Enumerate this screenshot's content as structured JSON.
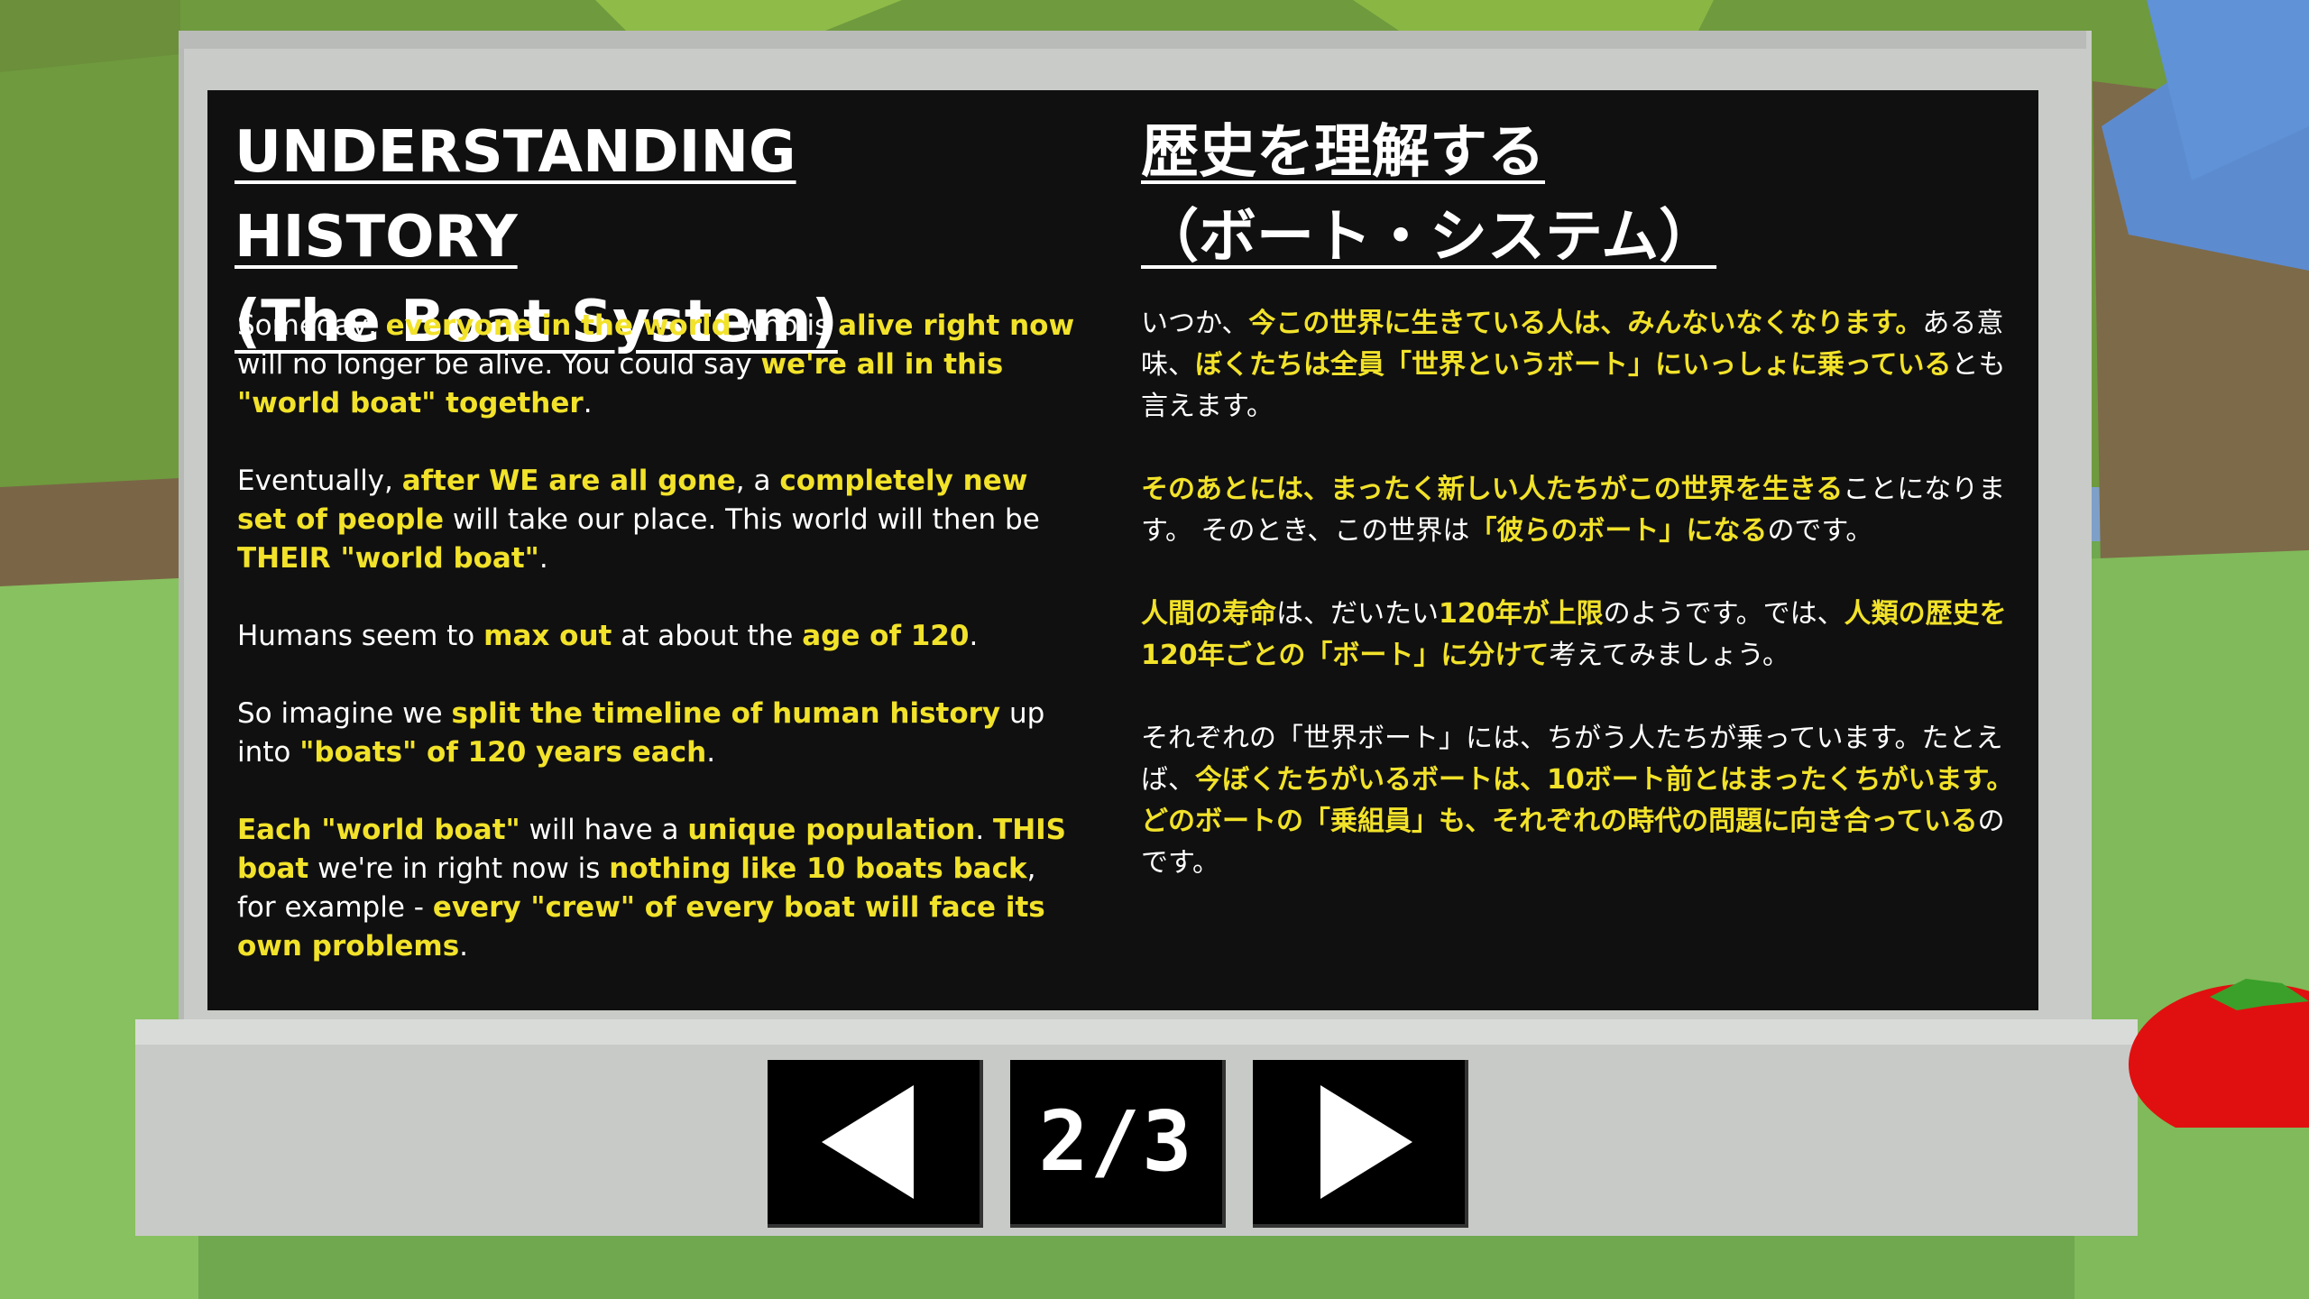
{
  "board": {
    "english": {
      "title_line1": "UNDERSTANDING HISTORY",
      "title_line2": "(The Boat System)",
      "paragraphs": [
        [
          {
            "t": "Someday, ",
            "h": false
          },
          {
            "t": "everyone in the world",
            "h": true
          },
          {
            "t": " who is ",
            "h": false
          },
          {
            "t": "alive right now",
            "h": true
          },
          {
            "t": " will no longer be alive. You could say ",
            "h": false
          },
          {
            "t": "we're all in this \"world boat\" together",
            "h": true
          },
          {
            "t": ".",
            "h": false
          }
        ],
        [
          {
            "t": "Eventually, ",
            "h": false
          },
          {
            "t": "after WE are all gone",
            "h": true
          },
          {
            "t": ", a ",
            "h": false
          },
          {
            "t": "completely new set of people",
            "h": true
          },
          {
            "t": " will take our place. This world will then be ",
            "h": false
          },
          {
            "t": "THEIR \"world boat\"",
            "h": true
          },
          {
            "t": ".",
            "h": false
          }
        ],
        [
          {
            "t": "Humans seem to ",
            "h": false
          },
          {
            "t": "max out",
            "h": true
          },
          {
            "t": " at about the ",
            "h": false
          },
          {
            "t": "age of 120",
            "h": true
          },
          {
            "t": ".",
            "h": false
          }
        ],
        [
          {
            "t": "So imagine we ",
            "h": false
          },
          {
            "t": "split the timeline of human history",
            "h": true
          },
          {
            "t": " up into ",
            "h": false
          },
          {
            "t": "\"boats\" of 120 years each",
            "h": true
          },
          {
            "t": ".",
            "h": false
          }
        ],
        [
          {
            "t": "Each \"world boat\"",
            "h": true
          },
          {
            "t": " will have a ",
            "h": false
          },
          {
            "t": "unique population",
            "h": true
          },
          {
            "t": ". ",
            "h": false
          },
          {
            "t": "THIS boat",
            "h": true
          },
          {
            "t": " we're in right now is ",
            "h": false
          },
          {
            "t": "nothing like 10 boats back",
            "h": true
          },
          {
            "t": ", for example - ",
            "h": false
          },
          {
            "t": "every \"crew\" of every boat will face its own problems",
            "h": true
          },
          {
            "t": ".",
            "h": false
          }
        ]
      ]
    },
    "japanese": {
      "title_line1": "歴史を理解する",
      "title_line2": "（ボート・システム）",
      "paragraphs": [
        [
          {
            "t": "いつか、",
            "h": false
          },
          {
            "t": "今この世界に生きている人は、みんないなくなります。",
            "h": true
          },
          {
            "t": "ある意味、",
            "h": false
          },
          {
            "t": "ぼくたちは全員「世界というボート」にいっしょに乗っている",
            "h": true
          },
          {
            "t": "とも言えます。",
            "h": false
          }
        ],
        [
          {
            "t": "そのあとには、まったく新しい人たちがこの世界を生きる",
            "h": true
          },
          {
            "t": "ことになります。 そのとき、この世界は",
            "h": false
          },
          {
            "t": "「彼らのボート」になる",
            "h": true
          },
          {
            "t": "のです。",
            "h": false
          }
        ],
        [
          {
            "t": "人間の寿命",
            "h": true
          },
          {
            "t": "は、だいたい",
            "h": false
          },
          {
            "t": "120年が上限",
            "h": true
          },
          {
            "t": "のようです。では、",
            "h": false
          },
          {
            "t": "人類の歴史を120年ごとの「ボート」に分けて",
            "h": true
          },
          {
            "t": "考えてみましょう。",
            "h": false
          }
        ],
        [
          {
            "t": "それぞれの「世界ボート」には、ちがう人たちが乗っています。たとえば、",
            "h": false
          },
          {
            "t": "今ぼくたちがいるボートは、10ボート前とはまったくちがいます。 どのボートの「乗組員」も、それぞれの時代の問題に向き合っている",
            "h": true
          },
          {
            "t": "のです。",
            "h": false
          }
        ]
      ]
    }
  },
  "nav": {
    "prev_icon": "triangle-left-icon",
    "next_icon": "triangle-right-icon",
    "page_indicator": "2/3"
  },
  "colors": {
    "highlight": "#f2e22a",
    "board_bg": "#101010",
    "frame": "#c9cbc8"
  }
}
